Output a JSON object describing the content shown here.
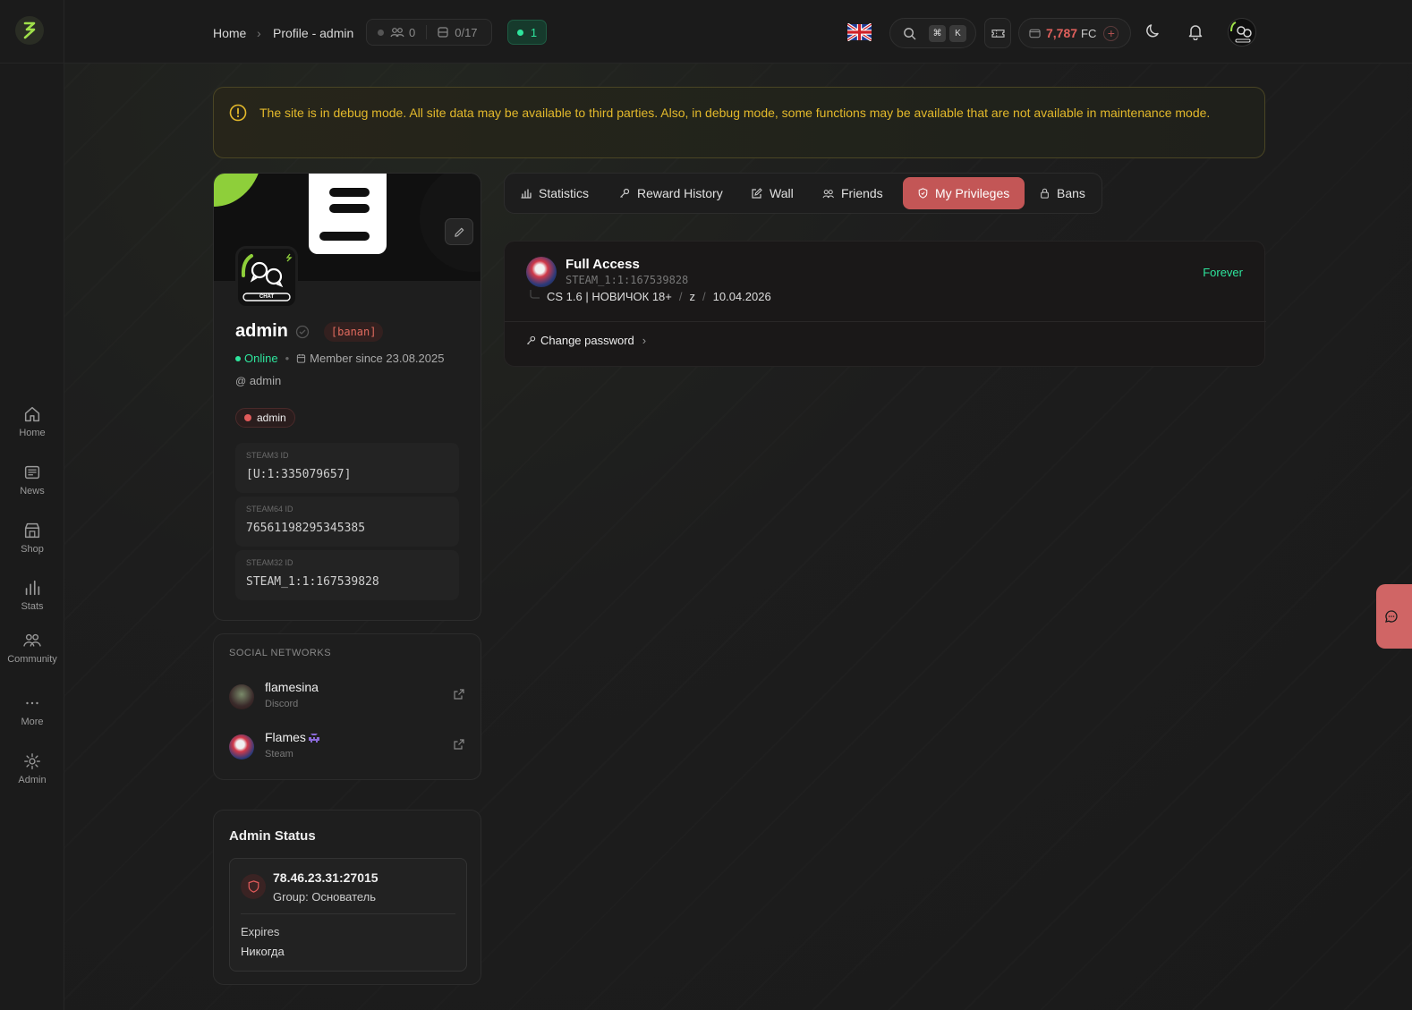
{
  "nav": {
    "home": "Home",
    "news": "News",
    "shop": "Shop",
    "stats": "Stats",
    "community": "Community",
    "more": "More",
    "admin": "Admin"
  },
  "breadcrumb": {
    "home": "Home",
    "current": "Profile - admin"
  },
  "online_counters": {
    "online": "0",
    "slots": "0/17",
    "servers": "1"
  },
  "search": {
    "key1": "⌘",
    "key2": "K"
  },
  "wallet": {
    "amount": "7,787",
    "currency": "FC"
  },
  "banner": {
    "text": "The site is in debug mode. All site data may be available to third parties. Also, in debug mode, some functions may be available that are not available in maintenance mode."
  },
  "profile": {
    "name": "admin",
    "tag": "[banan]",
    "status": "Online",
    "member_since": "Member since 23.08.2025",
    "handle": "admin",
    "role": "admin",
    "avatar_caption": "CHAT",
    "ids": [
      {
        "label": "STEAM3 ID",
        "value": "[U:1:335079657]"
      },
      {
        "label": "STEAM64 ID",
        "value": "76561198295345385"
      },
      {
        "label": "STEAM32 ID",
        "value": "STEAM_1:1:167539828"
      }
    ]
  },
  "social": {
    "title": "SOCIAL NETWORKS",
    "items": [
      {
        "name": "flamesina",
        "platform": "Discord"
      },
      {
        "name": "Flames",
        "platform": "Steam"
      }
    ]
  },
  "admin_status": {
    "title": "Admin Status",
    "server": "78.46.23.31:27015",
    "group": "Group: Основатель",
    "expires_label": "Expires",
    "expires_value": "Никогда"
  },
  "tabs": [
    {
      "label": "Statistics"
    },
    {
      "label": "Reward History"
    },
    {
      "label": "Wall"
    },
    {
      "label": "Friends"
    },
    {
      "label": "My Privileges"
    },
    {
      "label": "Bans"
    }
  ],
  "privilege": {
    "title": "Full Access",
    "steam_id": "STEAM_1:1:167539828",
    "server": "CS 1.6 | НОВИЧОК 18+",
    "sep": "/",
    "flag": "z",
    "date": "10.04.2026",
    "duration": "Forever",
    "change_password": "Change password"
  },
  "colors": {
    "accent_red": "#c35656",
    "online_green": "#2ee59d",
    "warning_yellow": "#e3b92b",
    "wallet_red": "#e0605c"
  }
}
